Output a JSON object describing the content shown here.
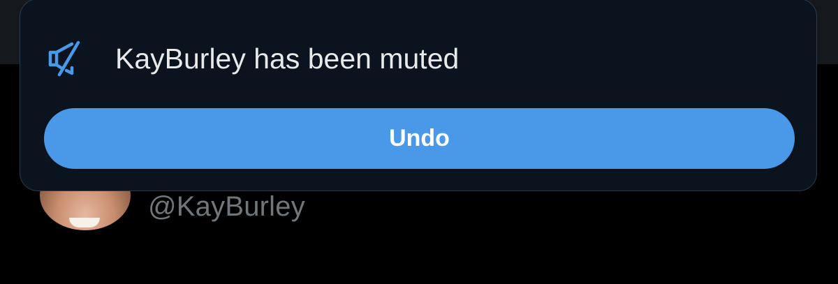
{
  "toast": {
    "icon": "muted-speaker-icon",
    "message": "KayBurley has been muted",
    "undo_label": "Undo"
  },
  "profile": {
    "handle": "@KayBurley"
  },
  "colors": {
    "accent": "#4a99e9",
    "toast_background": "#0b141e",
    "page_background": "#000000",
    "handle_text": "#71767b"
  }
}
